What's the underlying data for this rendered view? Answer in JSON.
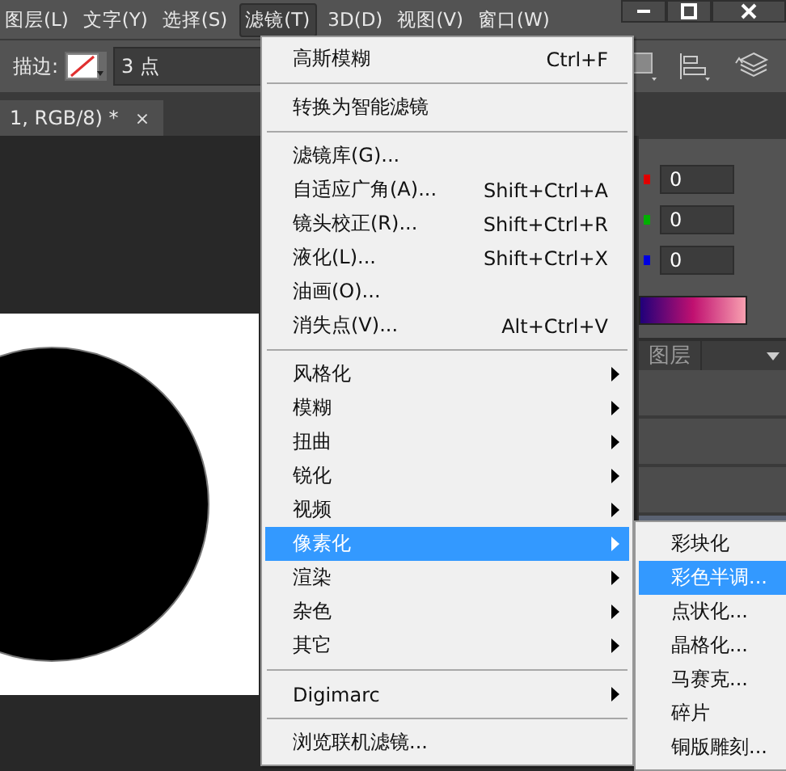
{
  "menu_bar": [
    {
      "label": "图层(L)",
      "selected": false
    },
    {
      "label": "文字(Y)",
      "selected": false
    },
    {
      "label": "选择(S)",
      "selected": false
    },
    {
      "label": "滤镜(T)",
      "selected": true
    },
    {
      "label": "3D(D)",
      "selected": false
    },
    {
      "label": "视图(V)",
      "selected": false
    },
    {
      "label": "窗口(W)",
      "selected": false
    }
  ],
  "options_bar": {
    "stroke_label": "描边:",
    "stroke_size": "3 点"
  },
  "document_tab": {
    "title": "1, RGB/8) *",
    "close": "×"
  },
  "color_panel": {
    "fields": [
      {
        "value": "0",
        "color": "#e00000"
      },
      {
        "value": "0",
        "color": "#00b000"
      },
      {
        "value": "0",
        "color": "#0000e0"
      }
    ]
  },
  "layers_panel": {
    "tab": "图层",
    "rows": [
      {
        "selected": false
      },
      {
        "selected": false
      },
      {
        "selected": false
      },
      {
        "selected": true
      }
    ]
  },
  "filter_menu": {
    "items": [
      {
        "kind": "item",
        "label": "高斯模糊",
        "shortcut": "Ctrl+F"
      },
      {
        "kind": "separator"
      },
      {
        "kind": "item",
        "label": "转换为智能滤镜"
      },
      {
        "kind": "separator"
      },
      {
        "kind": "item",
        "label": "滤镜库(G)..."
      },
      {
        "kind": "item",
        "label": "自适应广角(A)...",
        "shortcut": "Shift+Ctrl+A"
      },
      {
        "kind": "item",
        "label": "镜头校正(R)...",
        "shortcut": "Shift+Ctrl+R"
      },
      {
        "kind": "item",
        "label": "液化(L)...",
        "shortcut": "Shift+Ctrl+X"
      },
      {
        "kind": "item",
        "label": "油画(O)..."
      },
      {
        "kind": "item",
        "label": "消失点(V)...",
        "shortcut": "Alt+Ctrl+V"
      },
      {
        "kind": "separator"
      },
      {
        "kind": "submenu",
        "label": "风格化",
        "selected": false
      },
      {
        "kind": "submenu",
        "label": "模糊",
        "selected": false
      },
      {
        "kind": "submenu",
        "label": "扭曲",
        "selected": false
      },
      {
        "kind": "submenu",
        "label": "锐化",
        "selected": false
      },
      {
        "kind": "submenu",
        "label": "视频",
        "selected": false
      },
      {
        "kind": "submenu",
        "label": "像素化",
        "selected": true
      },
      {
        "kind": "submenu",
        "label": "渲染",
        "selected": false
      },
      {
        "kind": "submenu",
        "label": "杂色",
        "selected": false
      },
      {
        "kind": "submenu",
        "label": "其它",
        "selected": false
      },
      {
        "kind": "separator"
      },
      {
        "kind": "submenu",
        "label": "Digimarc",
        "selected": false
      },
      {
        "kind": "separator"
      },
      {
        "kind": "item",
        "label": "浏览联机滤镜..."
      }
    ]
  },
  "pixelate_submenu": {
    "items": [
      {
        "label": "彩块化",
        "selected": false
      },
      {
        "label": "彩色半调...",
        "selected": true
      },
      {
        "label": "点状化...",
        "selected": false
      },
      {
        "label": "晶格化...",
        "selected": false
      },
      {
        "label": "马赛克...",
        "selected": false
      },
      {
        "label": "碎片",
        "selected": false
      },
      {
        "label": "铜版雕刻...",
        "selected": false
      }
    ]
  }
}
